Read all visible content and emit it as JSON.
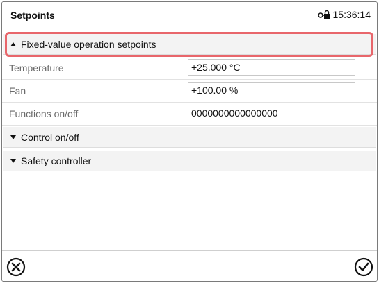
{
  "header": {
    "title": "Setpoints",
    "time": "15:36:14",
    "status_icon": "lock-network-icon"
  },
  "sections": {
    "fixed": {
      "label": "Fixed-value operation setpoints",
      "expanded": true
    },
    "control": {
      "label": "Control on/off",
      "expanded": false
    },
    "safety": {
      "label": "Safety controller",
      "expanded": false
    }
  },
  "fields": {
    "temperature": {
      "label": "Temperature",
      "value": "+25.000 °C"
    },
    "fan": {
      "label": "Fan",
      "value": "+100.00 %"
    },
    "functions": {
      "label": "Functions on/off",
      "value": "0000000000000000"
    }
  },
  "footer": {
    "cancel_icon": "cancel-circle-icon",
    "confirm_icon": "confirm-check-icon"
  },
  "colors": {
    "highlight": "#e8666b",
    "section_bg": "#f3f3f3"
  }
}
